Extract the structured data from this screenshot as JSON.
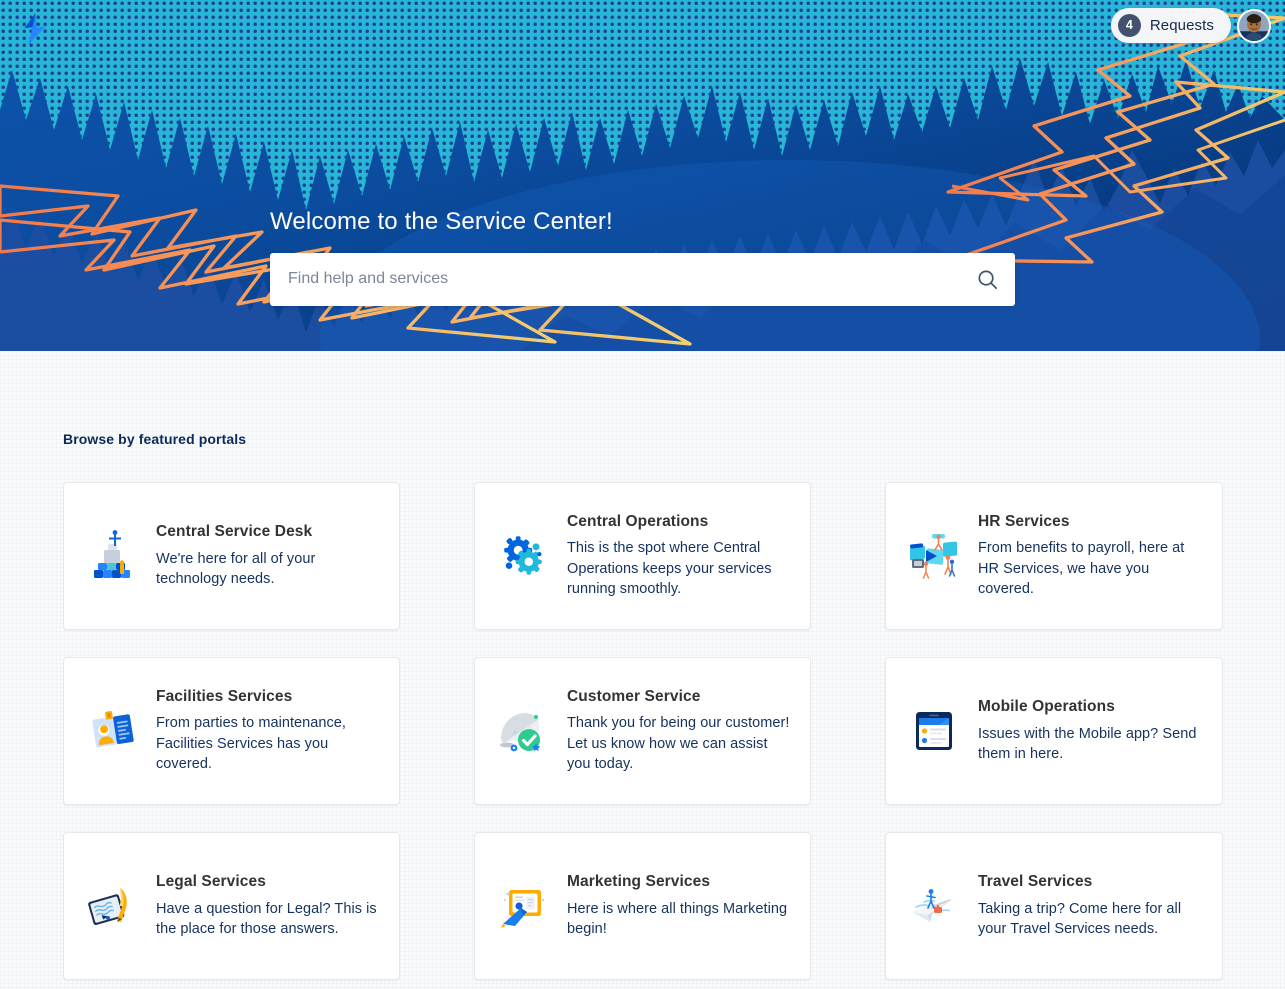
{
  "hero": {
    "logo_icon": "atlassian-lightning-logo",
    "title": "Welcome to the Service Center!",
    "search": {
      "placeholder": "Find help and services",
      "value": "",
      "icon": "search-icon"
    },
    "requests": {
      "count": "4",
      "label": "Requests"
    },
    "avatar_alt": "User profile photo",
    "colors": {
      "bg_deep_blue": "#052f6e",
      "bg_mid_blue": "#0b58b5",
      "mountain_cyan": "#29b8d8",
      "mountain_navy": "#1d4f9e",
      "halftone_navy": "#1a3a8f",
      "lightning_orange": "#f79553",
      "lightning_yellow": "#f2c45c"
    }
  },
  "main": {
    "section_heading": "Browse by featured portals",
    "cards": [
      {
        "title": "Central Service Desk",
        "description": "We're here for all of your technology needs.",
        "icon": "service-desk-building-icon"
      },
      {
        "title": "Central Operations",
        "description": "This is the spot where Central Operations keeps your services running smoothly.",
        "icon": "gears-icon"
      },
      {
        "title": "HR Services",
        "description": "From benefits to payroll, here at HR Services, we have you covered.",
        "icon": "hr-people-panels-icon"
      },
      {
        "title": "Facilities Services",
        "description": "From parties to maintenance, Facilities Services has you covered.",
        "icon": "facilities-badge-icon"
      },
      {
        "title": "Customer Service",
        "description": "Thank you for being our customer! Let us know how we can assist you today.",
        "icon": "customer-service-check-icon"
      },
      {
        "title": "Mobile Operations",
        "description": "Issues with the Mobile app? Send them in here.",
        "icon": "mobile-tablet-icon"
      },
      {
        "title": "Legal Services",
        "description": "Have a question for Legal? This is the place for those answers.",
        "icon": "legal-quill-document-icon"
      },
      {
        "title": "Marketing Services",
        "description": "Here is where all things Marketing begin!",
        "icon": "marketing-presentation-icon"
      },
      {
        "title": "Travel Services",
        "description": "Taking a trip? Come here for all your Travel Services needs.",
        "icon": "travel-paper-plane-icon"
      }
    ]
  }
}
